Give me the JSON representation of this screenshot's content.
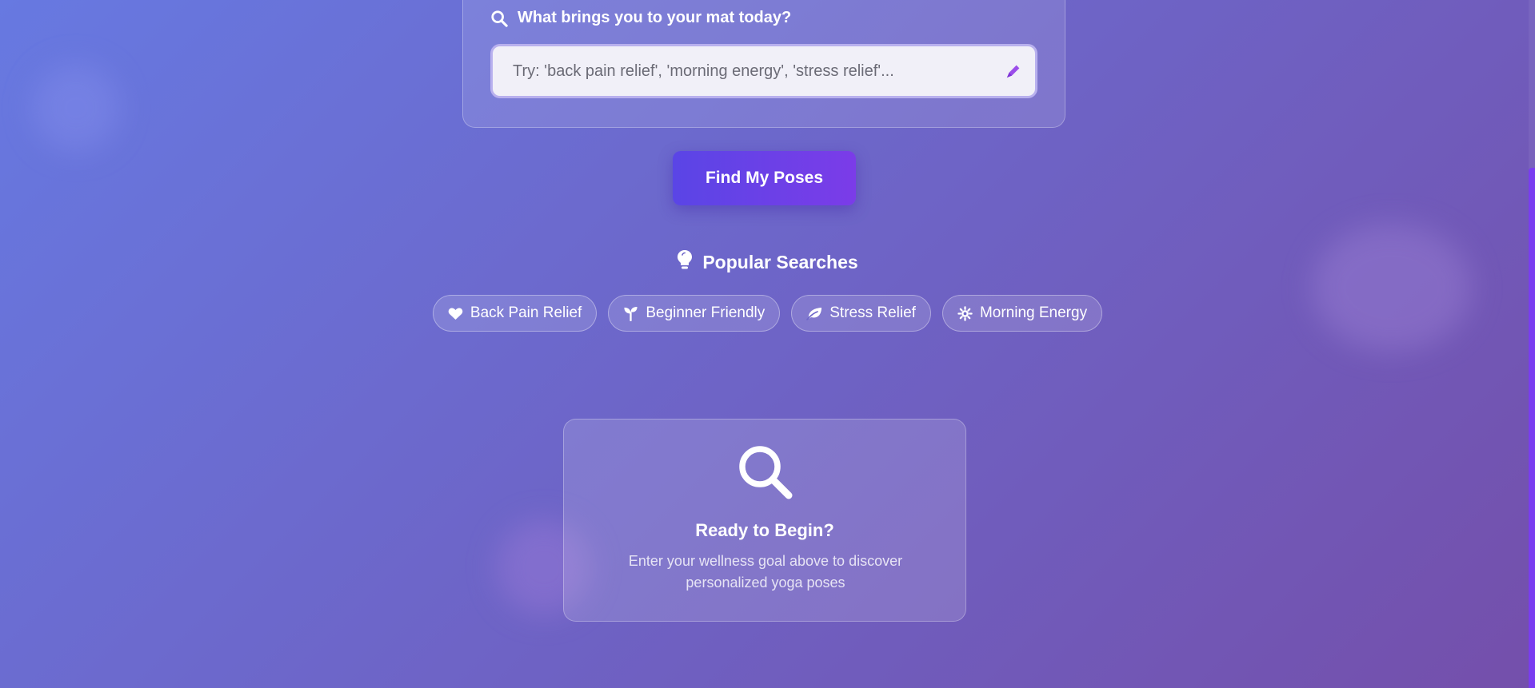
{
  "search": {
    "heading": "What brings you to your mat today?",
    "placeholder": "Try: 'back pain relief', 'morning energy', 'stress relief'...",
    "value": ""
  },
  "find_button": {
    "label": "Find My Poses"
  },
  "popular": {
    "heading": "Popular Searches",
    "items": [
      {
        "label": "Back Pain Relief",
        "icon": "heart-icon"
      },
      {
        "label": "Beginner Friendly",
        "icon": "seedling-icon"
      },
      {
        "label": "Stress Relief",
        "icon": "leaf-icon"
      },
      {
        "label": "Morning Energy",
        "icon": "sun-icon"
      }
    ]
  },
  "empty_state": {
    "icon": "search-icon",
    "title": "Ready to Begin?",
    "text": "Enter your wellness goal above to discover personalized yoga poses"
  },
  "colors": {
    "background_start": "#6779e1",
    "background_end": "#744fab",
    "button_start": "#5a45e6",
    "button_end": "#7b3ce8",
    "input_bg": "#f1f0f8",
    "accent": "#7a3cf0"
  }
}
